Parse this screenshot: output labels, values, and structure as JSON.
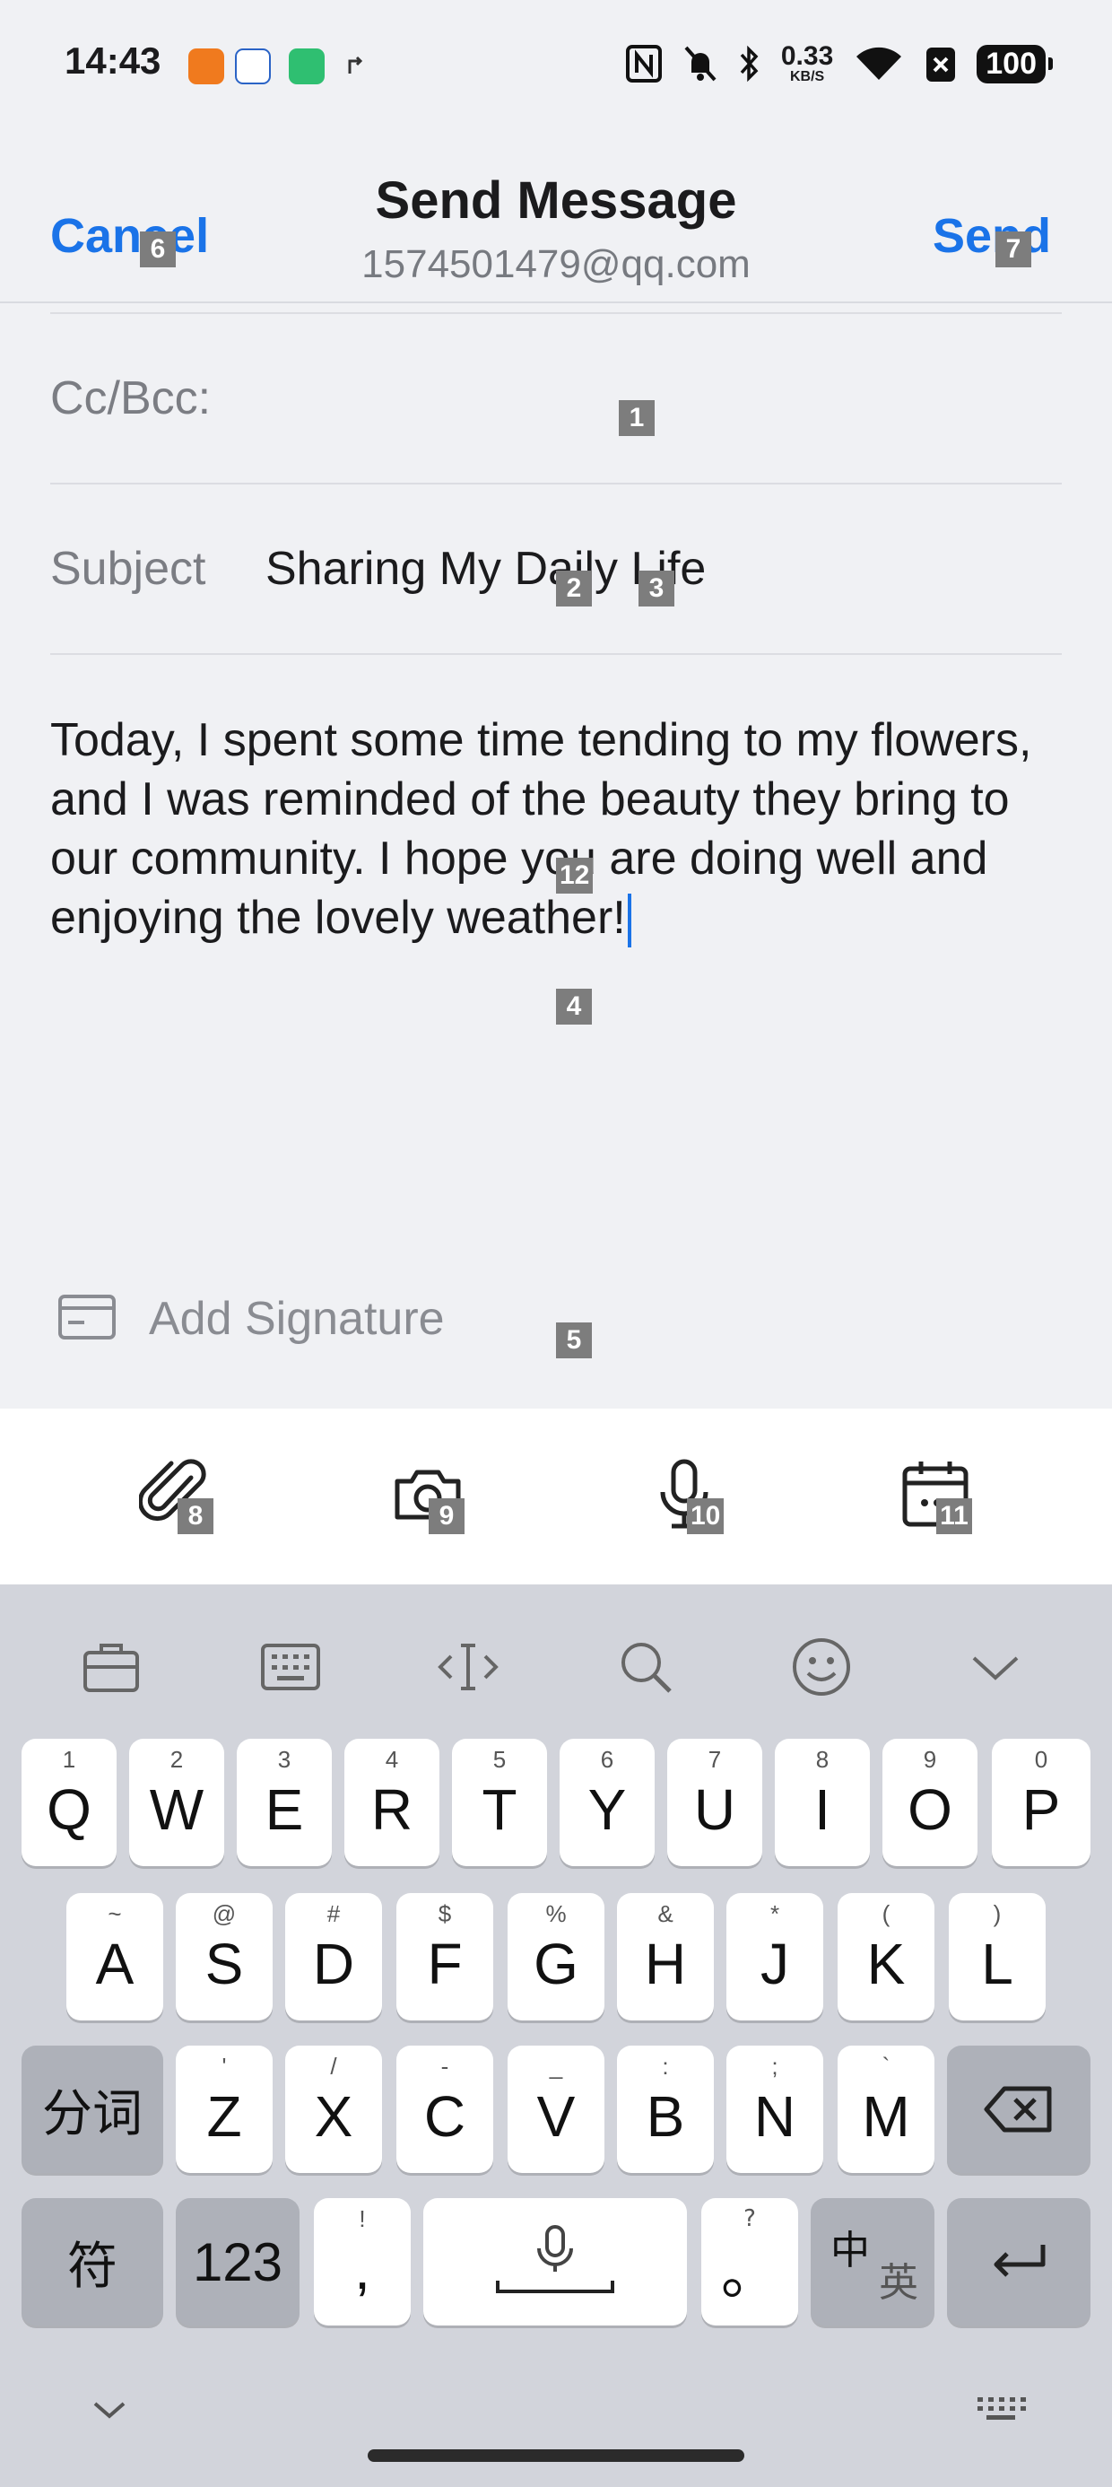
{
  "status_bar": {
    "time": "14:43",
    "net_speed": "0.33",
    "net_unit": "KB/S",
    "battery": "100"
  },
  "header": {
    "cancel_label": "Cancel",
    "title": "Send Message",
    "from_address": "1574501479@qq.com",
    "send_label": "Send"
  },
  "compose": {
    "cc_bcc_label": "Cc/Bcc:",
    "subject_label": "Subject",
    "subject_value": "Sharing My Daily Life",
    "body": "Today, I spent some time tending to my flowers, and I was reminded of the beauty they bring to our community. I hope you are doing well and enjoying the lovely weather!",
    "signature_label": "Add Signature"
  },
  "badges": {
    "b1": "1",
    "b2": "2",
    "b3": "3",
    "b4": "4",
    "b5": "5",
    "b6": "6",
    "b7": "7",
    "b8": "8",
    "b9": "9",
    "b10": "10",
    "b11": "11",
    "b12": "12"
  },
  "toolbar": {
    "icons": [
      "paperclip-icon",
      "camera-icon",
      "microphone-icon",
      "calendar-icon"
    ]
  },
  "keyboard": {
    "row1": [
      {
        "key": "Q",
        "hint": "1"
      },
      {
        "key": "W",
        "hint": "2"
      },
      {
        "key": "E",
        "hint": "3"
      },
      {
        "key": "R",
        "hint": "4"
      },
      {
        "key": "T",
        "hint": "5"
      },
      {
        "key": "Y",
        "hint": "6"
      },
      {
        "key": "U",
        "hint": "7"
      },
      {
        "key": "I",
        "hint": "8"
      },
      {
        "key": "O",
        "hint": "9"
      },
      {
        "key": "P",
        "hint": "0"
      }
    ],
    "row2": [
      {
        "key": "A",
        "hint": "~"
      },
      {
        "key": "S",
        "hint": "@"
      },
      {
        "key": "D",
        "hint": "#"
      },
      {
        "key": "F",
        "hint": "$"
      },
      {
        "key": "G",
        "hint": "%"
      },
      {
        "key": "H",
        "hint": "&"
      },
      {
        "key": "J",
        "hint": "*"
      },
      {
        "key": "K",
        "hint": "("
      },
      {
        "key": "L",
        "hint": ")"
      }
    ],
    "row3": [
      {
        "key": "Z",
        "hint": "'"
      },
      {
        "key": "X",
        "hint": "/"
      },
      {
        "key": "C",
        "hint": "-"
      },
      {
        "key": "V",
        "hint": "_"
      },
      {
        "key": "B",
        "hint": ":"
      },
      {
        "key": "N",
        "hint": ";"
      },
      {
        "key": "M",
        "hint": "`"
      }
    ],
    "fenci": "分词",
    "symbols": "符",
    "numbers": "123",
    "comma": ",",
    "comma_hint": "!",
    "period": "。",
    "period_hint": "?",
    "lang_zh": "中",
    "lang_en": "英",
    "accent_color": "#1a73e8"
  }
}
